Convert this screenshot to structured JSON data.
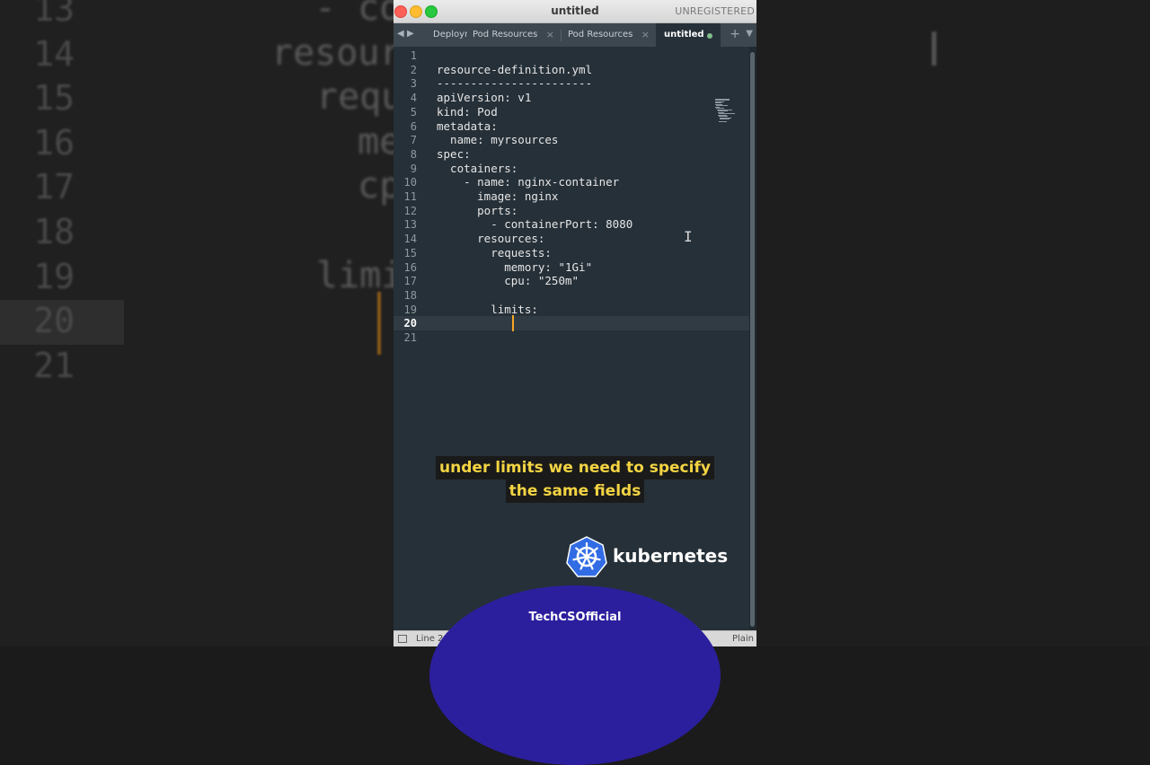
{
  "window": {
    "title": "untitled",
    "registration": "UNREGISTERED"
  },
  "tabs": [
    {
      "label": "Deploym",
      "active": false
    },
    {
      "label": "Pod Resources",
      "active": false
    },
    {
      "label": "Pod Resources",
      "active": false
    },
    {
      "label": "untitled",
      "active": true,
      "modified": true
    }
  ],
  "editor": {
    "current_line": 20,
    "line_numbers": [
      "1",
      "2",
      "3",
      "4",
      "5",
      "6",
      "7",
      "8",
      "9",
      "10",
      "11",
      "12",
      "13",
      "14",
      "15",
      "16",
      "17",
      "18",
      "19",
      "20",
      "21"
    ],
    "lines": [
      "",
      "resource-definition.yml",
      "-----------------------",
      "apiVersion: v1",
      "kind: Pod",
      "metadata:",
      "  name: myrsources",
      "spec:",
      "  cotainers:",
      "    - name: nginx-container",
      "      image: nginx",
      "      ports:",
      "        - containerPort: 8080",
      "      resources:",
      "        requests:",
      "          memory: \"1Gi\"",
      "          cpu: \"250m\"",
      "",
      "        limits:",
      "",
      ""
    ]
  },
  "statusbar": {
    "position": "Line 20, Column 12",
    "syntax": "Plain"
  },
  "background": {
    "line_numbers": [
      "13",
      "14",
      "15",
      "16",
      "17",
      "18",
      "19",
      "20",
      "21"
    ],
    "code": [
      "- co",
      "resour",
      "requ",
      "me",
      "cp",
      "",
      "limi",
      "",
      ""
    ]
  },
  "overlay": {
    "caption_lines": [
      "under limits we need to specify",
      "the same fields"
    ],
    "brand": "kubernetes",
    "channel": "TechCSOfficial"
  },
  "colors": {
    "editor_bg": "#263038",
    "cursor": "#f5a623",
    "caption_text": "#f3d443",
    "k8s_blue": "#326ce5"
  }
}
